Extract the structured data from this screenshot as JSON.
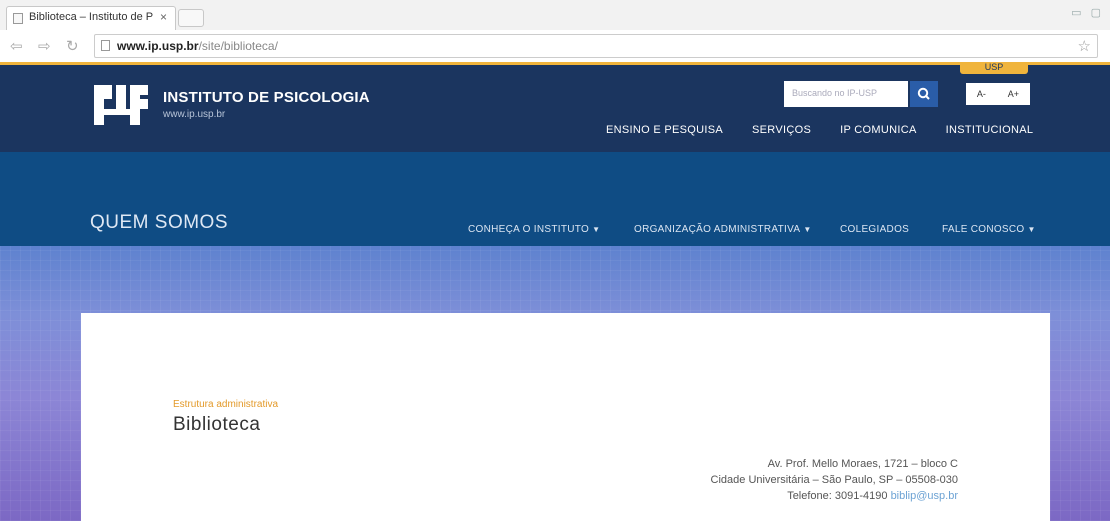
{
  "browser": {
    "tab_title": "Biblioteca – Instituto de P",
    "tab_close": "×",
    "url_domain": "www.ip.usp.br",
    "url_path": "/site/biblioteca/"
  },
  "header": {
    "usp_badge": "USP",
    "site_title": "INSTITUTO DE PSICOLOGIA",
    "site_url": "www.ip.usp.br",
    "search_placeholder": "Buscando no IP-USP",
    "font_smaller": "A-",
    "font_larger": "A+",
    "nav": [
      "ENSINO E PESQUISA",
      "SERVIÇOS",
      "IP COMUNICA",
      "INSTITUCIONAL"
    ]
  },
  "section": {
    "title": "QUEM SOMOS",
    "subnav": [
      {
        "label": "CONHEÇA O INSTITUTO",
        "dropdown": true
      },
      {
        "label": "ORGANIZAÇÃO ADMINISTRATIVA",
        "dropdown": true
      },
      {
        "label": "COLEGIADOS",
        "dropdown": false
      },
      {
        "label": "FALE CONOSCO",
        "dropdown": true
      }
    ]
  },
  "content": {
    "category": "Estrutura administrativa",
    "title": "Biblioteca",
    "address_line1": "Av. Prof. Mello Moraes, 1721 – bloco C",
    "address_line2": "Cidade Universitária – São Paulo, SP – 05508-030",
    "phone": "Telefone: 3091-4190",
    "email": "biblip@usp.br"
  },
  "colors": {
    "header_bg": "#1b355f",
    "section_bg": "#0f4c84",
    "accent": "#f0b43c",
    "category_text": "#e39a2a"
  }
}
